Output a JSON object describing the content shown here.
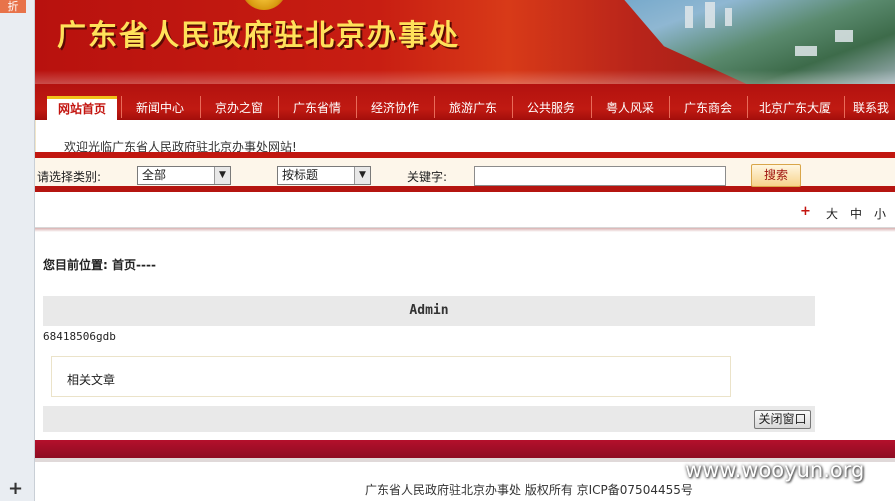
{
  "sidebar": {
    "fold_label": "折",
    "plus_symbol": "+"
  },
  "banner": {
    "title": "广东省人民政府驻北京办事处"
  },
  "nav": {
    "items": [
      {
        "label": "网站首页",
        "active": true
      },
      {
        "label": "新闻中心"
      },
      {
        "label": "京办之窗"
      },
      {
        "label": "广东省情"
      },
      {
        "label": "经济协作"
      },
      {
        "label": "旅游广东"
      },
      {
        "label": "公共服务"
      },
      {
        "label": "粤人风采"
      },
      {
        "label": "广东商会"
      },
      {
        "label": "北京广东大厦"
      },
      {
        "label": "联系我"
      }
    ]
  },
  "welcome": {
    "text": "欢迎光临广东省人民政府驻北京办事处网站!"
  },
  "search": {
    "category_label": "请选择类别:",
    "category_value": "全部",
    "field_value": "按标题",
    "keyword_label": "关键字:",
    "keyword_value": "",
    "button_label": "搜索"
  },
  "font_size": {
    "plus_symbol": "+",
    "large": "大",
    "medium": "中",
    "small": "小"
  },
  "breadcrumb": {
    "prefix": "您目前位置:",
    "home": "首页----"
  },
  "article": {
    "title": "Admin",
    "body": "68418506gdb",
    "related_label": "相关文章",
    "close_button": "关闭窗口"
  },
  "footer": {
    "text": "广东省人民政府驻北京办事处 版权所有 京ICP备07504455号"
  },
  "watermark": "www.wooyun.org",
  "colors": {
    "primary_red": "#c1170f",
    "accent_gold": "#ffe15a",
    "footer_band": "#b4102c"
  }
}
